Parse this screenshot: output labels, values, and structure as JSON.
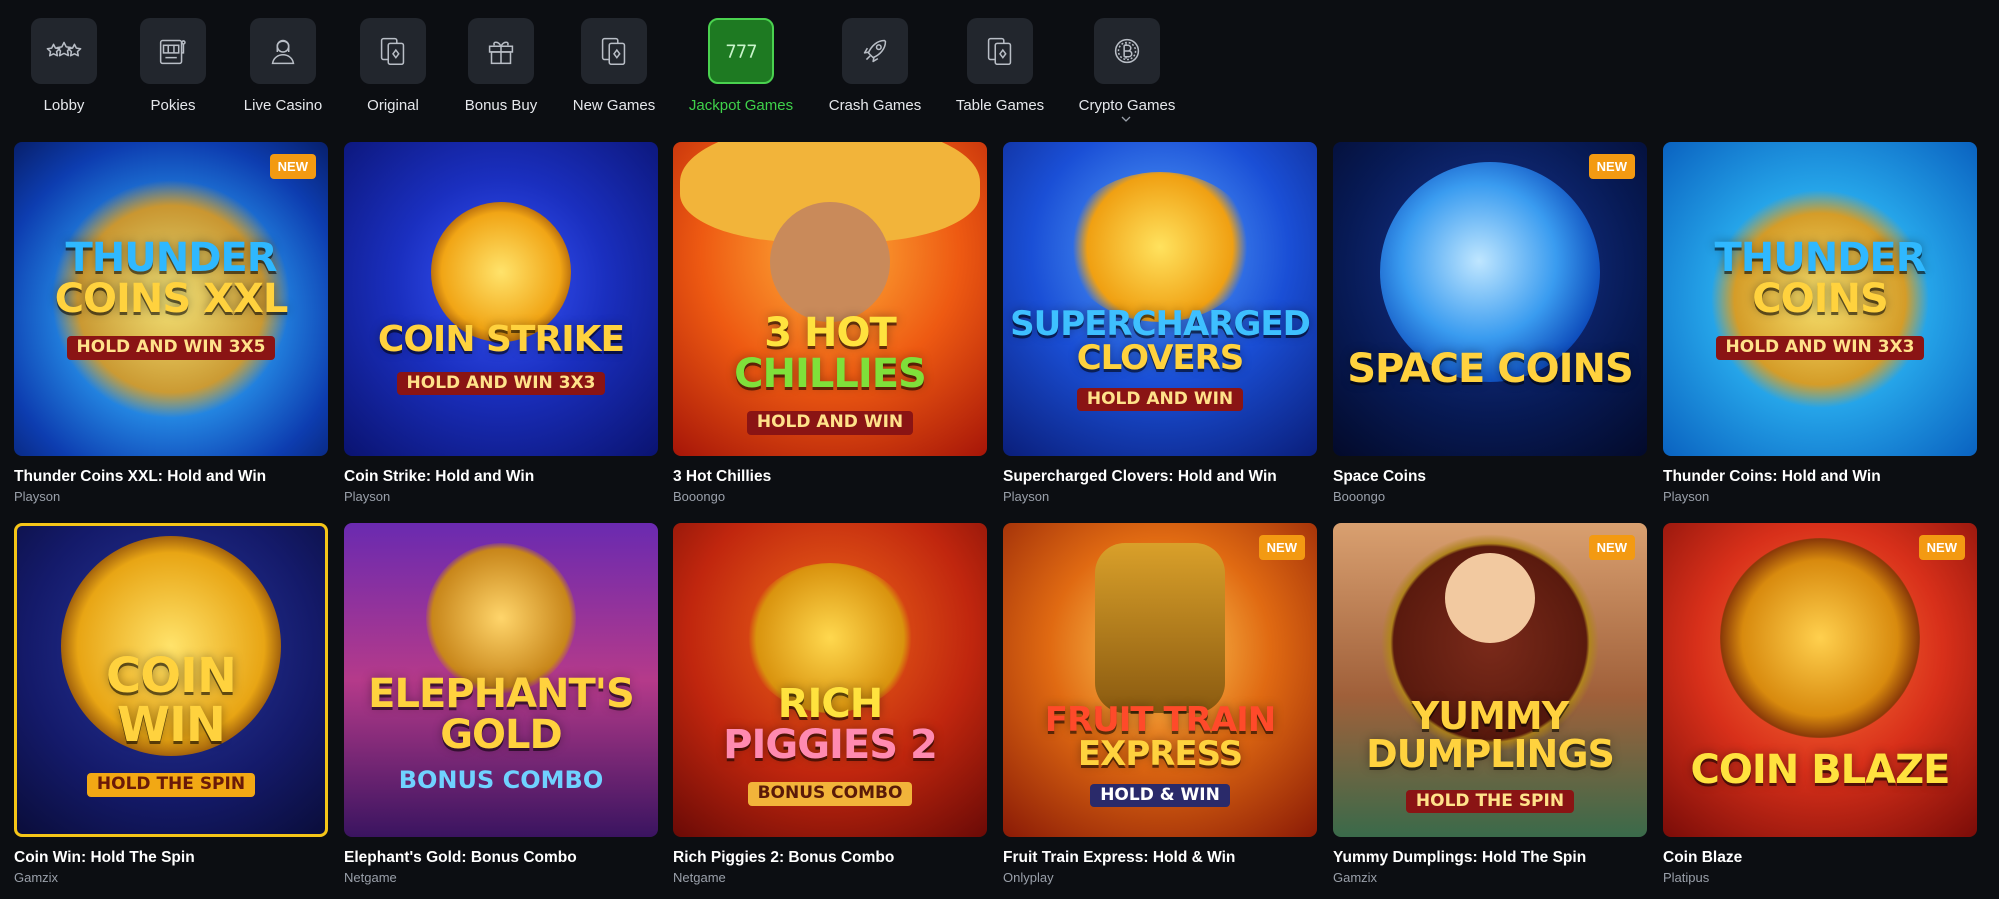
{
  "nav": {
    "items": [
      {
        "label": "Lobby",
        "icon": "stars-icon"
      },
      {
        "label": "Pokies",
        "icon": "slot-machine-icon"
      },
      {
        "label": "Live Casino",
        "icon": "dealer-icon"
      },
      {
        "label": "Original",
        "icon": "cards-icon"
      },
      {
        "label": "Bonus Buy",
        "icon": "gift-icon"
      },
      {
        "label": "New Games",
        "icon": "cards-icon"
      },
      {
        "label": "Jackpot Games",
        "icon": "777-icon",
        "active": true
      },
      {
        "label": "Crash Games",
        "icon": "rocket-icon"
      },
      {
        "label": "Table Games",
        "icon": "cards-icon"
      },
      {
        "label": "Crypto Games",
        "icon": "bitcoin-icon"
      }
    ],
    "active_color": "#3fd14a"
  },
  "badge_label": "NEW",
  "games": [
    {
      "title": "Thunder Coins XXL: Hold and Win",
      "provider": "Playson",
      "badge": true
    },
    {
      "title": "Coin Strike: Hold and Win",
      "provider": "Playson",
      "badge": false
    },
    {
      "title": "3 Hot Chillies",
      "provider": "Booongo",
      "badge": false
    },
    {
      "title": "Supercharged Clovers: Hold and Win",
      "provider": "Playson",
      "badge": false
    },
    {
      "title": "Space Coins",
      "provider": "Booongo",
      "badge": true
    },
    {
      "title": "Thunder Coins: Hold and Win",
      "provider": "Playson",
      "badge": false
    },
    {
      "title": "Coin Win: Hold The Spin",
      "provider": "Gamzix",
      "badge": false,
      "selected": true
    },
    {
      "title": "Elephant's Gold: Bonus Combo",
      "provider": "Netgame",
      "badge": false
    },
    {
      "title": "Rich Piggies 2: Bonus Combo",
      "provider": "Netgame",
      "badge": false
    },
    {
      "title": "Fruit Train Express: Hold & Win",
      "provider": "Onlyplay",
      "badge": true
    },
    {
      "title": "Yummy Dumplings: Hold The Spin",
      "provider": "Gamzix",
      "badge": true
    },
    {
      "title": "Coin Blaze",
      "provider": "Platipus",
      "badge": true
    }
  ],
  "art": [
    {
      "line1": "THUNDER",
      "line2": "COINS XXL",
      "sub": "HOLD AND WIN 3X5"
    },
    {
      "line1": "COIN STRIKE",
      "line2": "",
      "sub": "HOLD AND WIN 3X3"
    },
    {
      "line1": "3 HOT",
      "line2": "CHILLIES",
      "sub": "HOLD AND WIN"
    },
    {
      "line1": "SUPERCHARGED",
      "line2": "CLOVERS",
      "sub": "HOLD AND WIN"
    },
    {
      "line1": "SPACE COINS",
      "line2": "",
      "sub": ""
    },
    {
      "line1": "THUNDER",
      "line2": "COINS",
      "sub": "HOLD AND WIN 3X3"
    },
    {
      "line1": "COIN",
      "line2": "WIN",
      "sub": "HOLD THE SPIN"
    },
    {
      "line1": "ELEPHANT'S",
      "line2": "GOLD",
      "sub": "BONUS COMBO"
    },
    {
      "line1": "RICH",
      "line2": "PIGGIES 2",
      "sub": "BONUS COMBO"
    },
    {
      "line1": "FRUIT TRAIN",
      "line2": "EXPRESS",
      "sub": "HOLD & WIN"
    },
    {
      "line1": "YUMMY",
      "line2": "DUMPLINGS",
      "sub": "HOLD THE SPIN"
    },
    {
      "line1": "COIN BLAZE",
      "line2": "",
      "sub": ""
    }
  ]
}
